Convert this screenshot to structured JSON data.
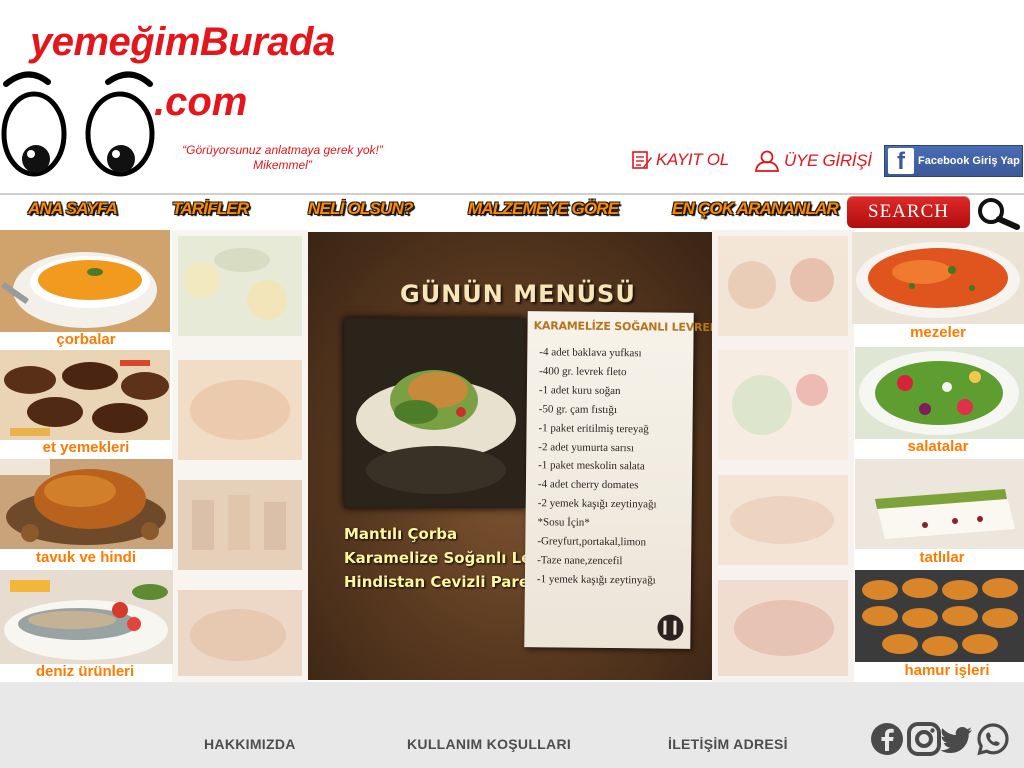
{
  "brand": {
    "name": "yemeğimBurada",
    "tld": ".com",
    "slogan_line1": "“Görüyorsunuz anlatmaya gerek yok!”",
    "slogan_line2": "Mikemmel”"
  },
  "header": {
    "register_label": "KAYIT OL",
    "login_label": "ÜYE GİRİŞİ",
    "facebook_label": "Facebook Giriş Yap"
  },
  "nav": {
    "items": [
      "ANA SAYFA",
      "TARİFLER",
      "NELİ OLSUN?",
      "MALZEMEYE GÖRE",
      "EN ÇOK ARANANLAR"
    ],
    "search_label": "SEARCH"
  },
  "categories": {
    "left": [
      "çorbalar",
      "et yemekleri",
      "tavuk ve hindi",
      "deniz ürünleri"
    ],
    "right": [
      "mezeler",
      "salatalar",
      "tatlılar",
      "hamur işleri"
    ]
  },
  "menu_board": {
    "title": "GÜNÜN MENÜSÜ",
    "dishes": [
      "Mantılı Çorba",
      "Karamelize Soğanlı Levrek",
      "Hindistan Cevizli Pare"
    ],
    "recipe_title": "KARAMELİZE SOĞANLI LEVREK",
    "recipe_items": [
      "-4 adet baklava yufkası",
      "-400 gr. levrek fleto",
      "-1 adet kuru soğan",
      "-50 gr. çam fıstığı",
      "-1 paket eritilmiş tereyağ",
      "-2 adet yumurta sarısı",
      "-1 paket meskolin salata",
      "-4 adet cherry domates",
      "-2 yemek kaşığı zeytinyağı",
      "*Sosu İçin*",
      "-Greyfurt,portakal,limon",
      "-Taze nane,zencefil",
      "-1 yemek kaşığı zeytinyağı"
    ]
  },
  "footer": {
    "links": [
      "HAKKIMIZDA",
      "KULLANIM KOŞULLARI",
      "İLETİŞİM ADRESİ"
    ],
    "social": [
      "facebook-icon",
      "instagram-icon",
      "twitter-icon",
      "whatsapp-icon"
    ]
  },
  "colors": {
    "brand_red": "#e3161b",
    "nav_orange": "#ff8a00",
    "category_orange": "#ff7a00",
    "facebook_blue": "#3b5998",
    "footer_bg": "#e8e8e8"
  }
}
